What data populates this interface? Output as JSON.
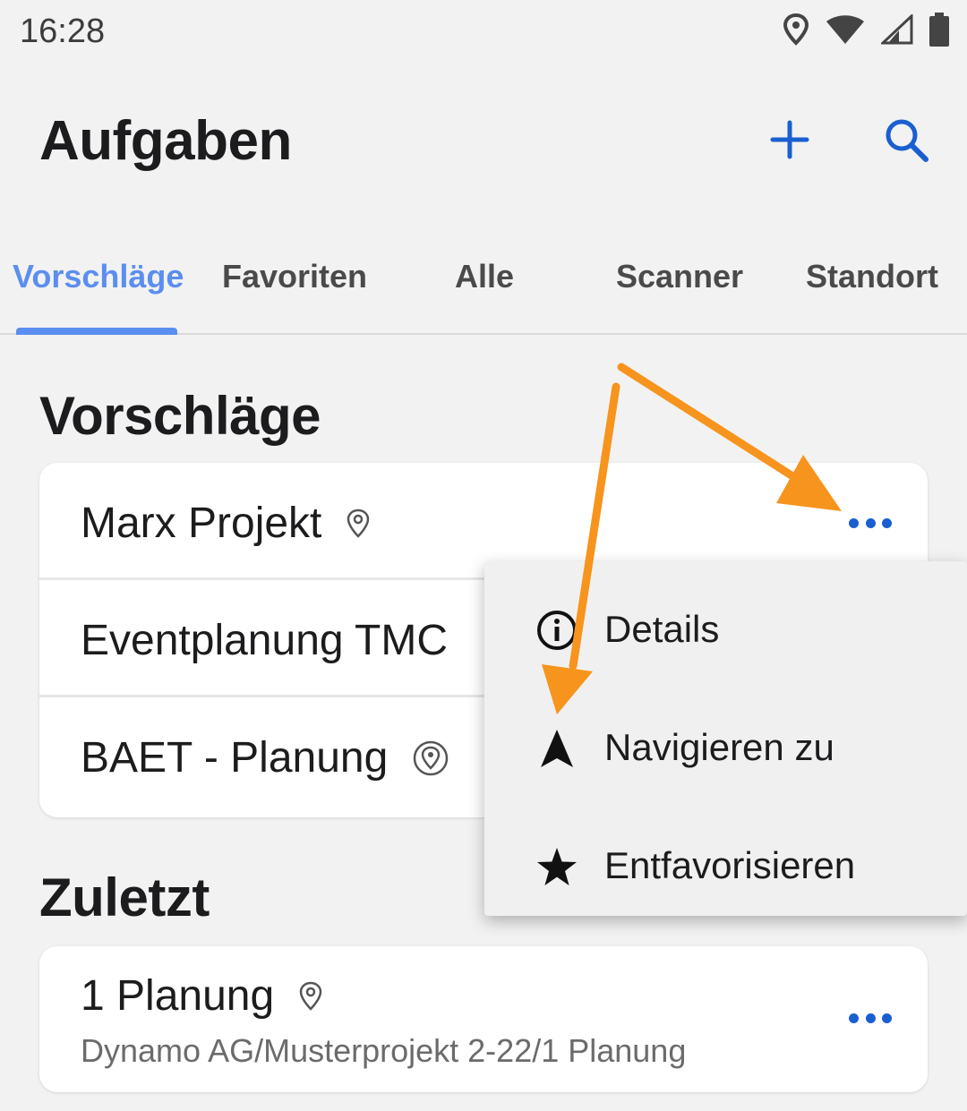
{
  "status_bar": {
    "time": "16:28",
    "icons": [
      "location-icon",
      "wifi-icon",
      "signal-icon",
      "battery-icon"
    ]
  },
  "app_bar": {
    "title": "Aufgaben",
    "actions": [
      "plus-icon",
      "search-icon"
    ]
  },
  "tabs": [
    {
      "label": "Vorschläge",
      "active": true
    },
    {
      "label": "Favoriten",
      "active": false
    },
    {
      "label": "Alle",
      "active": false
    },
    {
      "label": "Scanner",
      "active": false
    },
    {
      "label": "Standort",
      "active": false
    }
  ],
  "suggestions": {
    "title": "Vorschläge",
    "items": [
      {
        "label": "Marx Projekt",
        "icon": "location-pin-icon"
      },
      {
        "label": "Eventplanung TMC",
        "icon": ""
      },
      {
        "label": "BAET - Planung",
        "icon": "location-target-icon"
      }
    ]
  },
  "recent": {
    "title": "Zuletzt",
    "items": [
      {
        "label": "1 Planung",
        "subtitle": "Dynamo AG/Musterprojekt 2-22/1 Planung",
        "icon": "location-pin-icon"
      }
    ]
  },
  "context_menu": {
    "items": [
      {
        "label": "Details",
        "icon": "info-icon"
      },
      {
        "label": "Navigieren zu",
        "icon": "navigation-arrow-icon"
      },
      {
        "label": "Entfavorisieren",
        "icon": "star-icon"
      }
    ]
  },
  "colors": {
    "accent": "#5b8ef0",
    "action_blue": "#1a5fd1",
    "annotation_orange": "#f7941d",
    "background": "#f2f2f2"
  }
}
